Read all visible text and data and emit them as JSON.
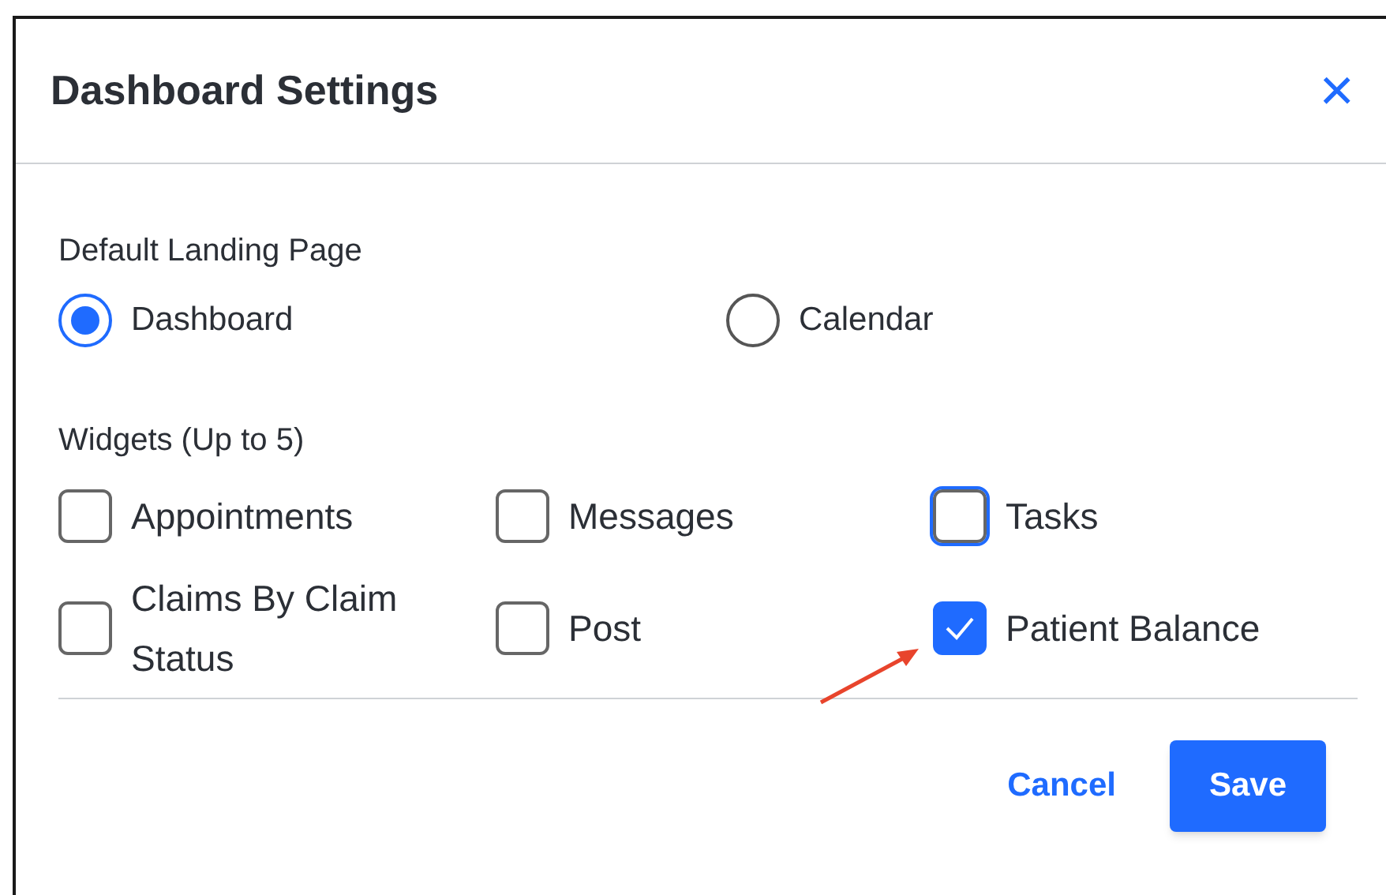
{
  "dialog": {
    "title": "Dashboard Settings",
    "close": "×"
  },
  "landing": {
    "label": "Default Landing Page",
    "options": [
      {
        "label": "Dashboard",
        "selected": true
      },
      {
        "label": "Calendar",
        "selected": false
      }
    ]
  },
  "widgets": {
    "label": "Widgets (Up to 5)",
    "items": [
      {
        "label": "Appointments",
        "checked": false,
        "focused": false
      },
      {
        "label": "Messages",
        "checked": false,
        "focused": false
      },
      {
        "label": "Tasks",
        "checked": false,
        "focused": true
      },
      {
        "label": "Claims By Claim Status",
        "checked": false,
        "focused": false
      },
      {
        "label": "Post",
        "checked": false,
        "focused": false
      },
      {
        "label": "Patient Balance",
        "checked": true,
        "focused": false
      }
    ]
  },
  "buttons": [
    {
      "label": "Cancel",
      "kind": "link"
    },
    {
      "label": "Save",
      "kind": "primary"
    }
  ]
}
